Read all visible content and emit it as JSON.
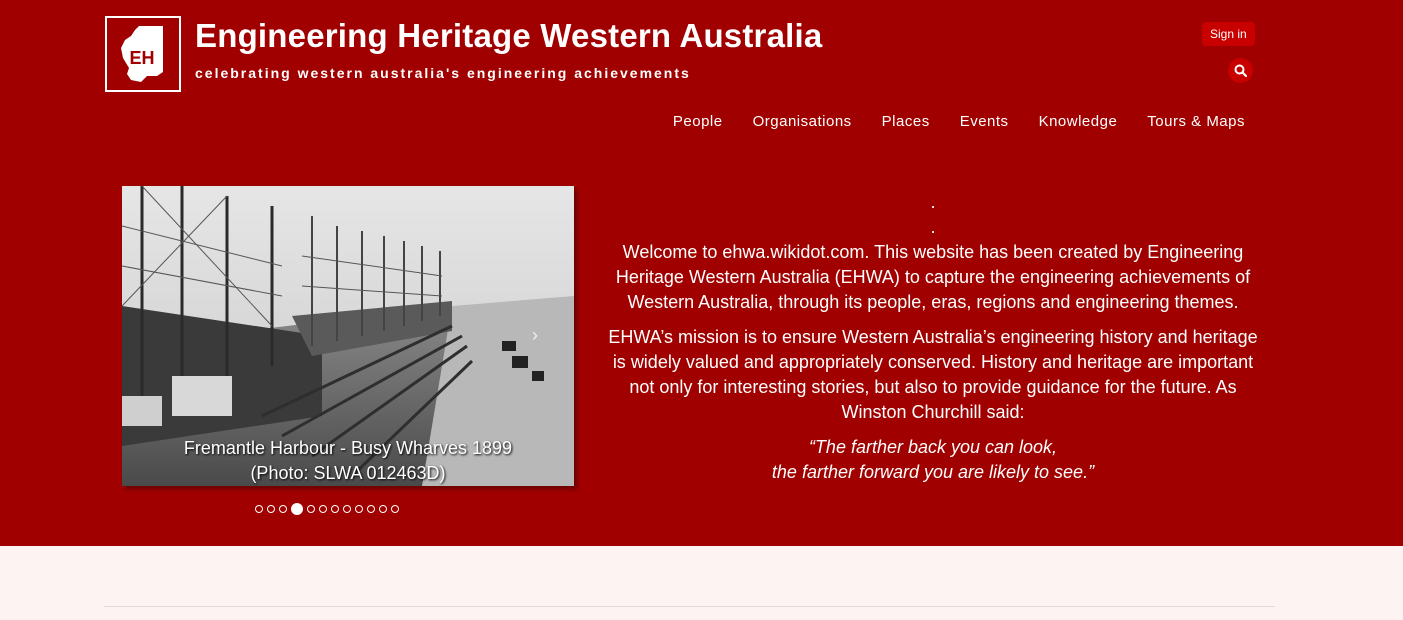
{
  "header": {
    "logo_text": "EH",
    "title": "Engineering Heritage Western Australia",
    "tagline": "celebrating western australia's engineering achievements",
    "signin_label": "Sign in",
    "search_icon": "search-icon"
  },
  "nav": {
    "items": [
      "People",
      "Organisations",
      "Places",
      "Events",
      "Knowledge",
      "Tours & Maps"
    ]
  },
  "slideshow": {
    "caption_line1": "Fremantle Harbour - Busy Wharves 1899",
    "caption_line2": "(Photo: SLWA 012463D)",
    "dot_count": 12,
    "active_index": 3,
    "prev_glyph": "‹",
    "next_glyph": "›"
  },
  "intro": {
    "sep1": ".",
    "sep2": ".",
    "para1": "Welcome to ehwa.wikidot.com. This website has been created by Engineering Heritage Western Australia (EHWA) to capture the engineering achievements of Western Australia, through its people, eras, regions and engineering themes.",
    "para2": "EHWA’s mission is to ensure Western Australia’s engineering history and heritage is widely valued and appropriately conserved. History and heritage are important not only for interesting stories, but also to provide guidance for the future. As Winston Churchill said:",
    "quote_line1": "“The farther back you can look,",
    "quote_line2": "the farther forward you are likely to see.”"
  },
  "colors": {
    "hero_bg": "#a00000",
    "button_bg": "#c90000",
    "page_bg": "#fdf3f3"
  }
}
